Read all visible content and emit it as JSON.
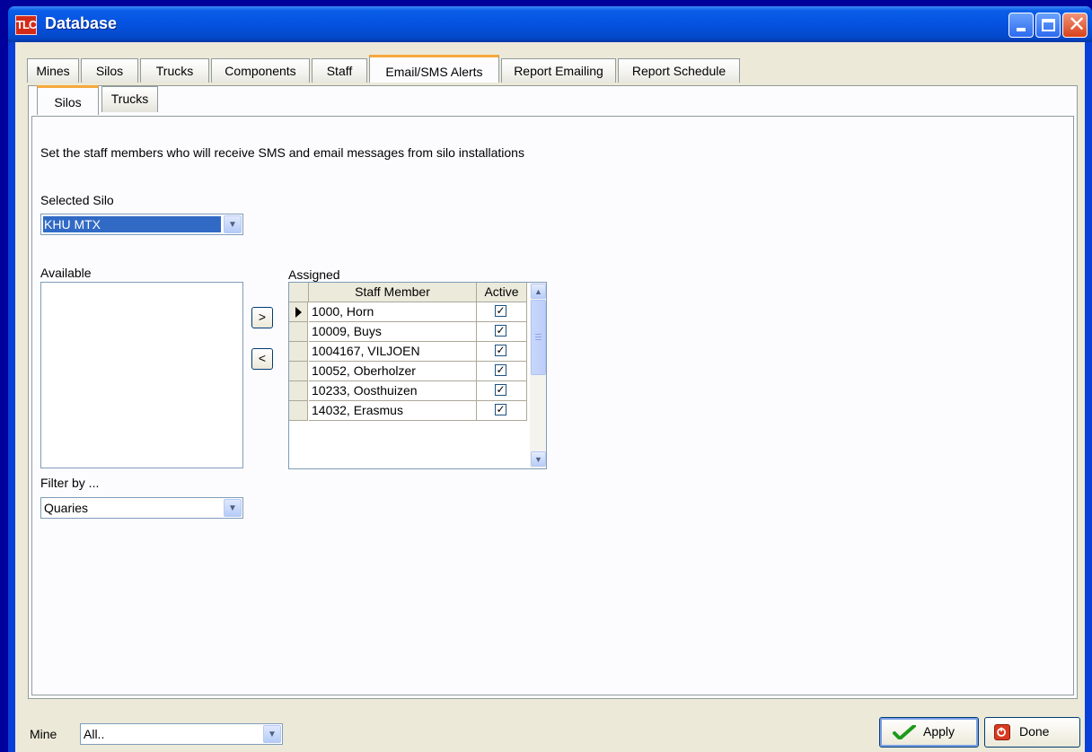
{
  "window": {
    "title": "Database",
    "logo": "TLC",
    "controls": {
      "minimize_icon": "minimize-icon",
      "maximize_icon": "maximize-icon",
      "close_icon": "close-icon",
      "close_glyph": "✕"
    }
  },
  "main_tabs": [
    {
      "label": "Mines"
    },
    {
      "label": "Silos"
    },
    {
      "label": "Trucks"
    },
    {
      "label": "Components"
    },
    {
      "label": "Staff"
    },
    {
      "label": "Email/SMS Alerts",
      "active": true
    },
    {
      "label": "Report Emailing"
    },
    {
      "label": "Report Schedule"
    }
  ],
  "sub_tabs": [
    {
      "label": "Silos",
      "active": true
    },
    {
      "label": "Trucks"
    }
  ],
  "panel": {
    "description": "Set the staff members who will receive SMS and email messages from silo installations",
    "selected_silo_label": "Selected Silo",
    "selected_silo_value": "KHU MTX",
    "available_label": "Available",
    "available_items": [],
    "assigned_label": "Assigned",
    "add_button": ">",
    "remove_button": "<",
    "filter_label": "Filter by ...",
    "filter_value": "Quaries"
  },
  "assigned_grid": {
    "columns": [
      "Staff Member",
      "Active"
    ],
    "rows": [
      {
        "staff": "1000, Horn",
        "active": true,
        "current": true
      },
      {
        "staff": "10009, Buys",
        "active": true
      },
      {
        "staff": "1004167, VILJOEN",
        "active": true
      },
      {
        "staff": "10052, Oberholzer",
        "active": true
      },
      {
        "staff": "10233, Oosthuizen",
        "active": true
      },
      {
        "staff": "14032, Erasmus",
        "active": true
      }
    ]
  },
  "footer": {
    "mine_label": "Mine",
    "mine_value": "All..",
    "apply_label": "Apply",
    "done_label": "Done"
  },
  "colors": {
    "desktop": "#00009a",
    "title_bar": "#0552e0",
    "tab_highlight": "#f6a83c",
    "selection": "#316ac5",
    "apply_check": "#1b9a1b",
    "done_icon": "#d83b20"
  }
}
